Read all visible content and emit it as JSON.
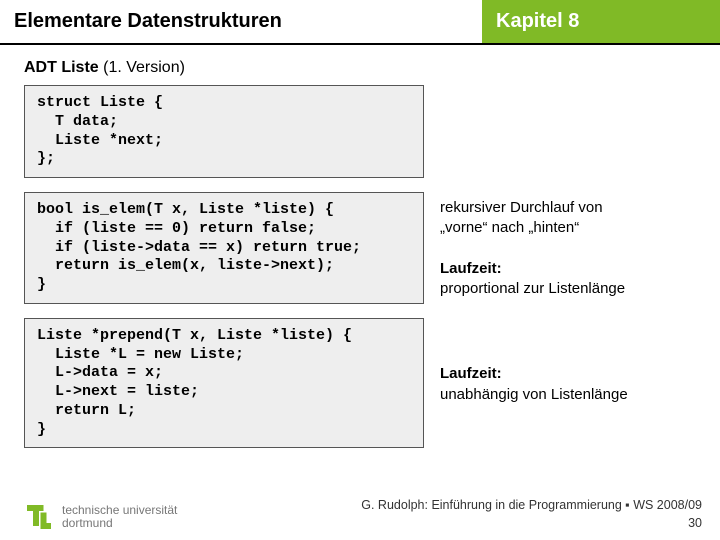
{
  "header": {
    "title_left": "Elementare Datenstrukturen",
    "title_right": "Kapitel 8"
  },
  "subtitle": {
    "bold": "ADT Liste",
    "light": " (1. Version)"
  },
  "blocks": [
    {
      "code": "struct Liste {\n  T data;\n  Liste *next;\n};",
      "annotation_lines": []
    },
    {
      "code": "bool is_elem(T x, Liste *liste) {\n  if (liste == 0) return false;\n  if (liste->data == x) return true;\n  return is_elem(x, liste->next);\n}",
      "annotation_lines": [
        {
          "bold": false,
          "text": "rekursiver Durchlauf von"
        },
        {
          "bold": false,
          "text": "„vorne“ nach „hinten“"
        },
        {
          "bold": false,
          "text": ""
        },
        {
          "bold": true,
          "text": "Laufzeit:"
        },
        {
          "bold": false,
          "text": "proportional zur Listenlänge"
        }
      ]
    },
    {
      "code": "Liste *prepend(T x, Liste *liste) {\n  Liste *L = new Liste;\n  L->data = x;\n  L->next = liste;\n  return L;\n}",
      "annotation_lines": [
        {
          "bold": false,
          "text": ""
        },
        {
          "bold": false,
          "text": ""
        },
        {
          "bold": true,
          "text": "Laufzeit:"
        },
        {
          "bold": false,
          "text": "unabhängig von Listenlänge"
        }
      ]
    }
  ],
  "footer": {
    "uni_line1": "technische universität",
    "uni_line2": "dortmund",
    "credit": "G. Rudolph: Einführung in die Programmierung ▪ WS 2008/09",
    "page": "30"
  }
}
